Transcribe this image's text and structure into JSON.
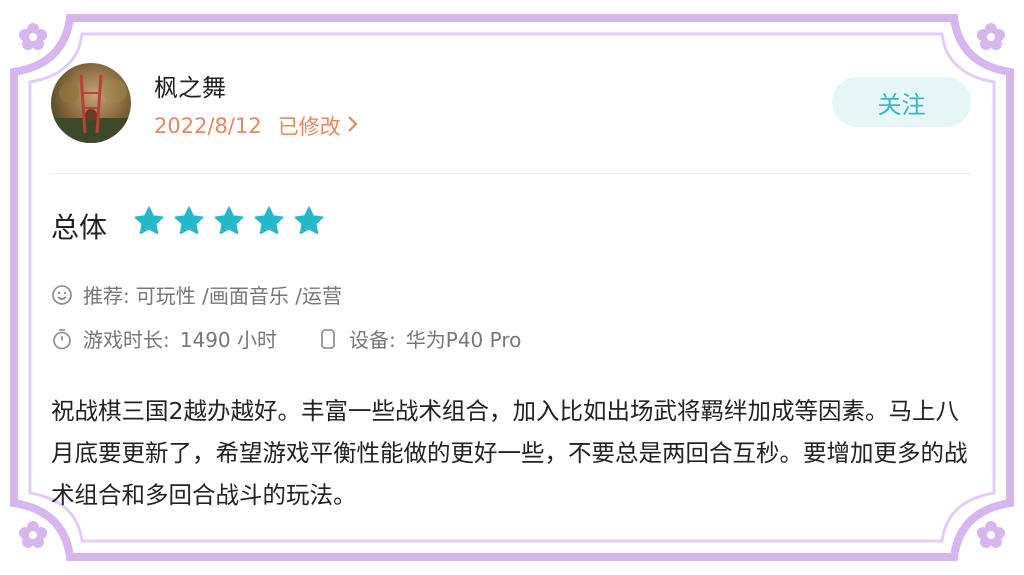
{
  "user": {
    "name": "枫之舞",
    "date": "2022/8/12",
    "edited_label": "已修改",
    "avatar_desc": "avatar"
  },
  "follow_button": {
    "label": "关注"
  },
  "rating": {
    "label": "总体",
    "stars": 5,
    "max_stars": 5,
    "star_color": "#25b8c9"
  },
  "recommend": {
    "prefix": "推荐:",
    "tags": "可玩性 /画面音乐 /运营"
  },
  "playtime": {
    "label": "游戏时长:",
    "value": "1490 小时"
  },
  "device": {
    "label": "设备:",
    "value": "华为P40 Pro"
  },
  "review": {
    "text": "祝战棋三国2越办越好。丰富一些战术组合，加入比如出场武将羁绊加成等因素。马上八月底要更新了，希望游戏平衡性能做的更好一些，不要总是两回合互秒。要增加更多的战术组合和多回合战斗的玩法。"
  },
  "colors": {
    "frame": "#d7b6ee",
    "accent_orange": "#e8865e",
    "follow_bg": "#e6f6f7",
    "follow_text": "#36b9c3"
  }
}
